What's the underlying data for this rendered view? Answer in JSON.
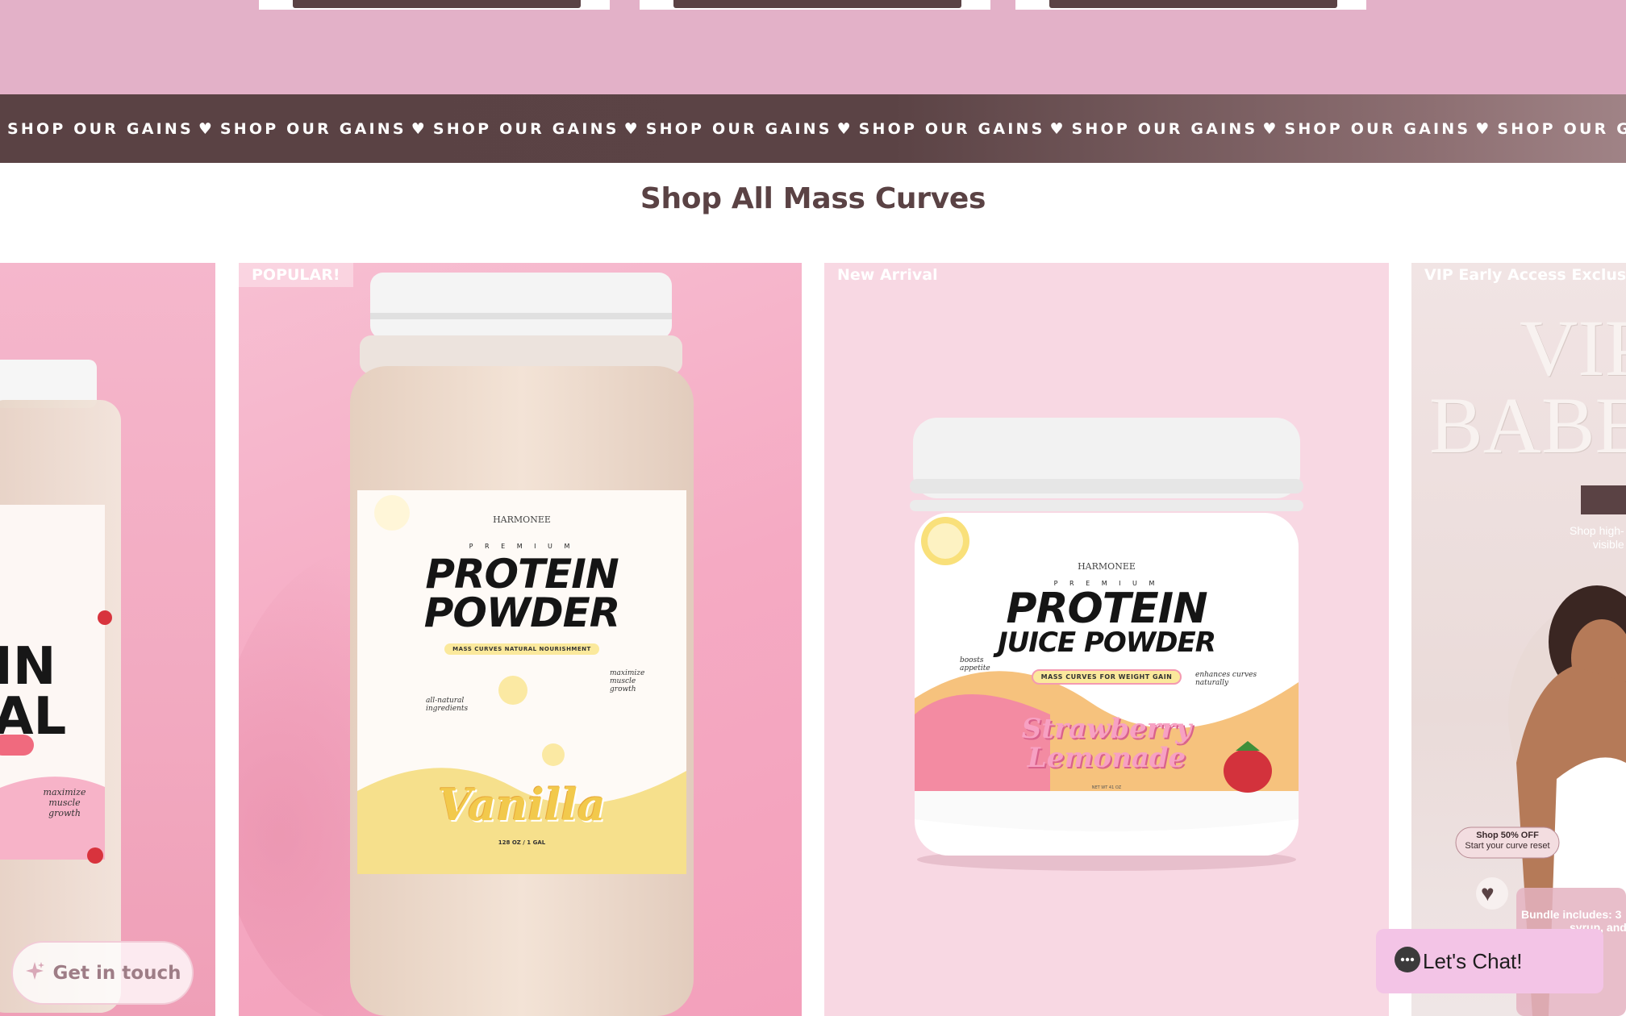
{
  "marquee": {
    "items": [
      "SHOP OUR GAINS",
      "SHOP OUR GAINS",
      "SHOP OUR GAINS",
      "SHOP OUR GAINS",
      "SHOP OUR GAINS",
      "SHOP OUR GAINS",
      "SHOP OUR GAINS",
      "SHOP OUR GAINS"
    ],
    "separator": "♥"
  },
  "section": {
    "title": "Shop All Mass Curves"
  },
  "products": [
    {
      "badge": "",
      "label_title_1": "IN",
      "label_title_2": "AL",
      "label_note": "maximize muscle growth"
    },
    {
      "badge": "POPULAR!",
      "brand": "HARMONEE",
      "premium": "P R E M I U M",
      "title_1": "PROTEIN",
      "title_2": "POWDER",
      "tagline": "MASS CURVES NATURAL NOURISHMENT",
      "note_left": "all-natural ingredients",
      "note_right": "maximize muscle growth",
      "flavor": "Vanilla",
      "size": "128 OZ / 1 GAL"
    },
    {
      "badge": "New Arrival",
      "brand": "HARMONEE",
      "premium": "P R E M I U M",
      "title_1": "PROTEIN",
      "title_2": "JUICE POWDER",
      "tagline": "MASS CURVES FOR WEIGHT GAIN",
      "note_left": "boosts appetite",
      "note_right": "enhances curves naturally",
      "flavor_1": "Strawberry",
      "flavor_2": "Lemonade",
      "size": "NET WT 41 OZ"
    },
    {
      "badge": "VIP Early Access Exclusiv",
      "hero_1": "VIP",
      "hero_2": "BABE",
      "sub_1": "Shop high-",
      "sub_2": "visible",
      "pill_1": "Shop 50% OFF",
      "pill_2": "Start your curve reset",
      "bundle_1": "Bundle includes: 3",
      "bundle_2": "syrup, and"
    }
  ],
  "widgets": {
    "get_in_touch": "Get in touch",
    "lets_chat": "Let's Chat!"
  },
  "colors": {
    "brand_brown": "#5a4244",
    "top_band_pink": "#e3b1c8",
    "chat_pink": "#f3c4e6"
  }
}
